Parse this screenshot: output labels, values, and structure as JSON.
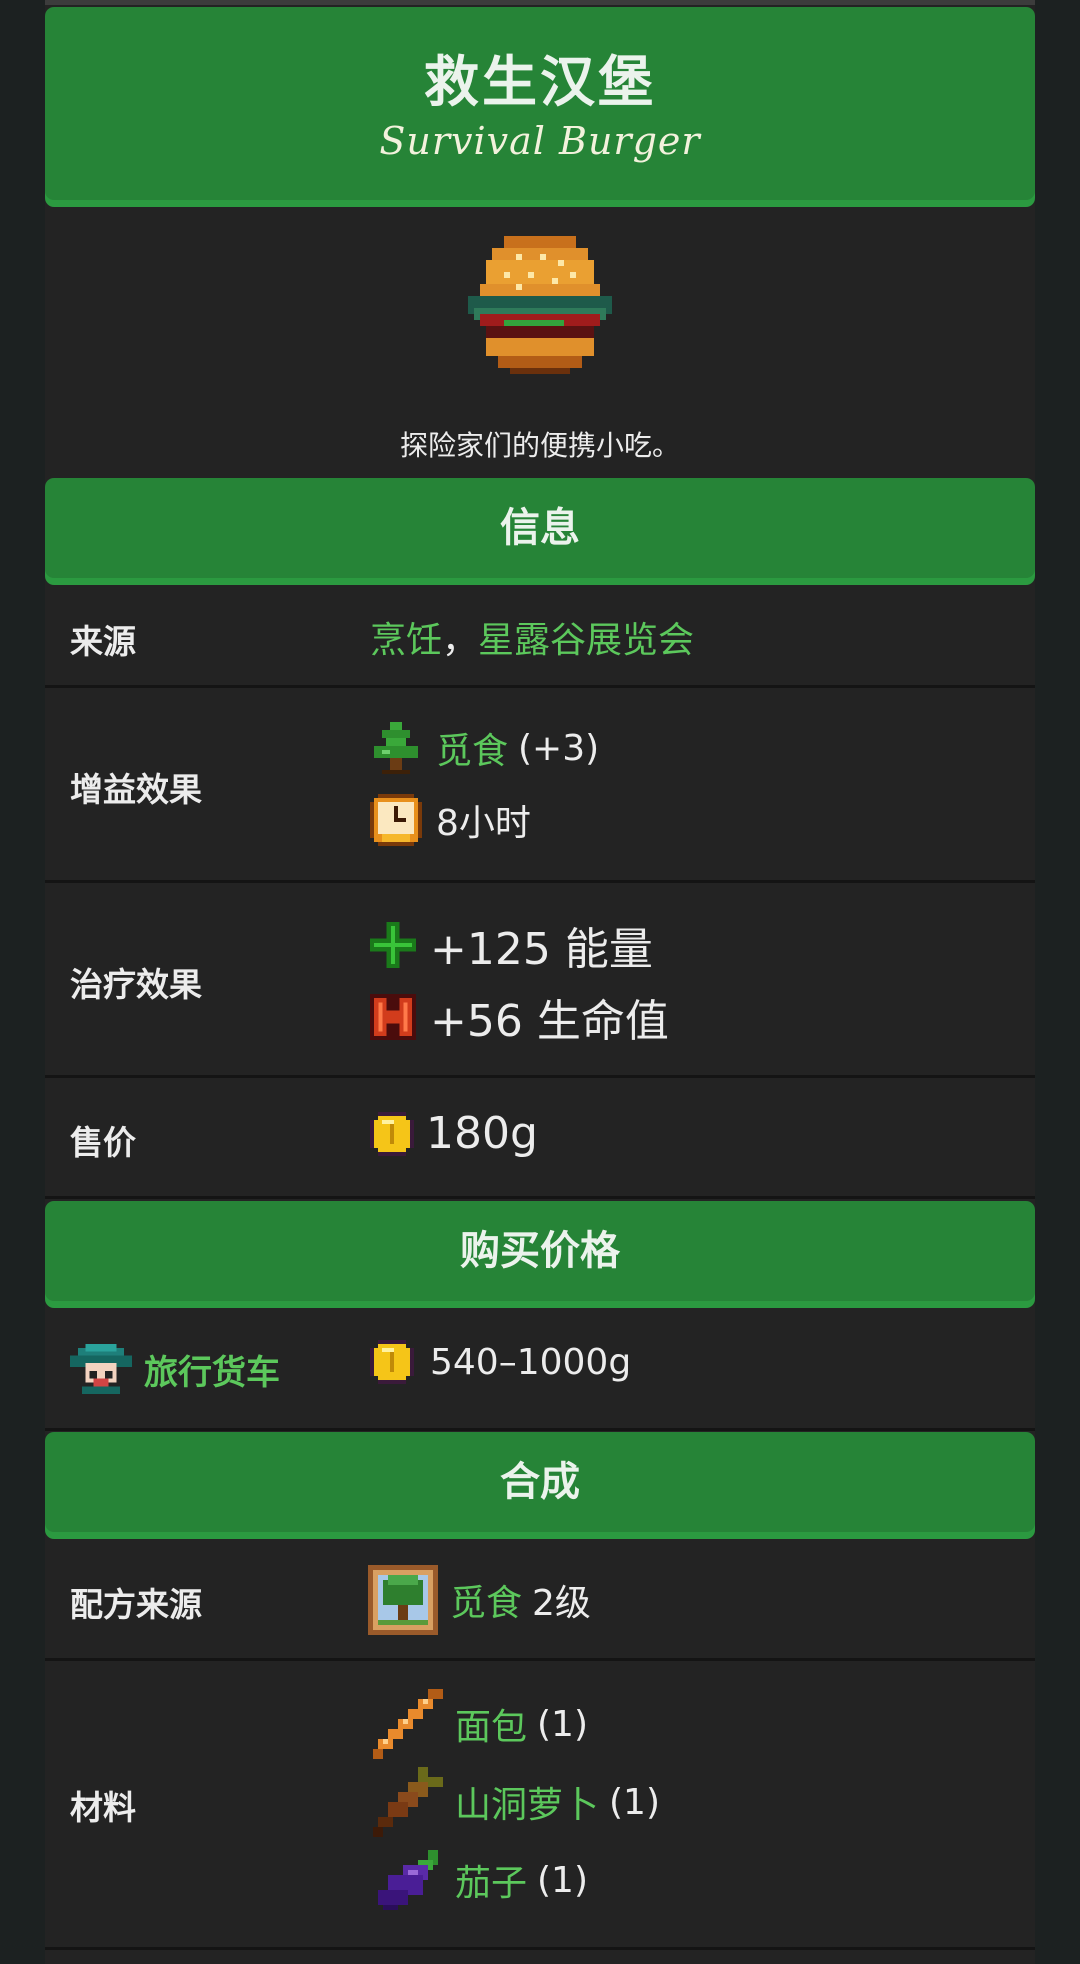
{
  "item": {
    "name_zh": "救生汉堡",
    "name_en": "Survival Burger",
    "description": "探险家们的便携小吃。",
    "icon": "survival-burger-icon"
  },
  "info": {
    "heading": "信息",
    "source": {
      "label": "来源",
      "links": [
        "烹饪",
        "星露谷展览会"
      ],
      "separator": "，"
    },
    "buff": {
      "label": "增益效果",
      "skill": "觅食",
      "amount": "(+3)",
      "duration": "8小时",
      "skill_icon": "foraging-tree-icon",
      "duration_icon": "clock-icon"
    },
    "heal": {
      "label": "治疗效果",
      "energy": "+125 能量",
      "health": "+56 生命值",
      "energy_icon": "energy-icon",
      "health_icon": "health-icon"
    },
    "sell": {
      "label": "售价",
      "price": "180g",
      "icon": "gold-coin-icon"
    }
  },
  "buy": {
    "heading": "购买价格",
    "vendor": "旅行货车",
    "vendor_icon": "traveling-merchant-icon",
    "price": "540–1000g"
  },
  "crafting": {
    "heading": "合成",
    "recipe_source": {
      "label": "配方来源",
      "skill": "觅食",
      "level": "2级",
      "icon": "foraging-skill-icon"
    },
    "ingredients": {
      "label": "材料",
      "items": [
        {
          "name": "面包",
          "qty": "(1)",
          "icon": "bread-icon"
        },
        {
          "name": "山洞萝卜",
          "qty": "(1)",
          "icon": "cave-carrot-icon"
        },
        {
          "name": "茄子",
          "qty": "(1)",
          "icon": "eggplant-icon"
        }
      ]
    }
  },
  "colors": {
    "accent_green": "#268437",
    "link_green": "#5cc85c",
    "panel": "#232323",
    "page": "#1c2121"
  }
}
